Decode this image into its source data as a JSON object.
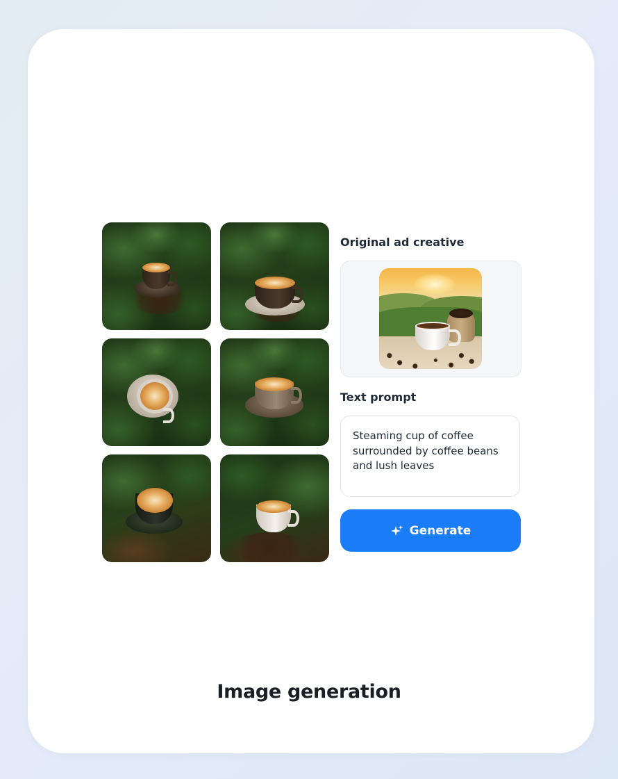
{
  "original_section": {
    "label": "Original ad creative",
    "image_alt": "Coffee cup with beans and sack in front of sunrise over plantation hills"
  },
  "prompt_section": {
    "label": "Text prompt",
    "value": "Steaming cup of coffee surrounded by coffee beans and lush leaves"
  },
  "generate_button": {
    "label": "Generate",
    "icon": "sparkle-icon",
    "color": "#1a7cf7"
  },
  "generated_grid": {
    "images": [
      {
        "alt": "Coffee cup on saucer among coffee leaves"
      },
      {
        "alt": "Latte cup on saucer among coffee leaves"
      },
      {
        "alt": "Top-down latte on white saucer among leaves"
      },
      {
        "alt": "Latte cup on dark saucer among leaves"
      },
      {
        "alt": "Latte art cup among leaves and beans"
      },
      {
        "alt": "White latte cup on coffee beans among leaves"
      }
    ]
  },
  "caption": "Image generation"
}
